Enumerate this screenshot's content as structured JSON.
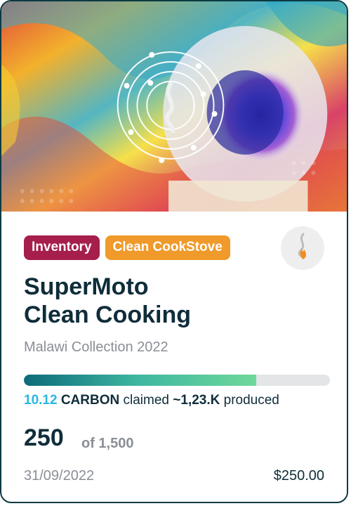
{
  "card": {
    "tags": {
      "status": "Inventory",
      "category": "Clean CookStove"
    },
    "title_line1": "SuperMoto",
    "title_line2": "Clean Cooking",
    "collection": "Malawi Collection 2022",
    "progress_fraction": 0.76,
    "claim": {
      "amount": "10.12",
      "unit": "CARBON",
      "claimed_text": "claimed",
      "produced_prefix": "~",
      "produced_amount": "1,23.K",
      "produced_text": "produced"
    },
    "count": "250",
    "count_total": "of 1,500",
    "date": "31/09/2022",
    "price": "$250.00",
    "icons": {
      "hero": "cookstove-artwork",
      "logo": "flame-icon"
    },
    "colors": {
      "inventory_tag": "#a51e4c",
      "category_tag": "#ef9a2a",
      "claim_amount": "#2ab8e0",
      "text_dark": "#0f2d3a",
      "text_muted": "#8a8f96"
    }
  }
}
